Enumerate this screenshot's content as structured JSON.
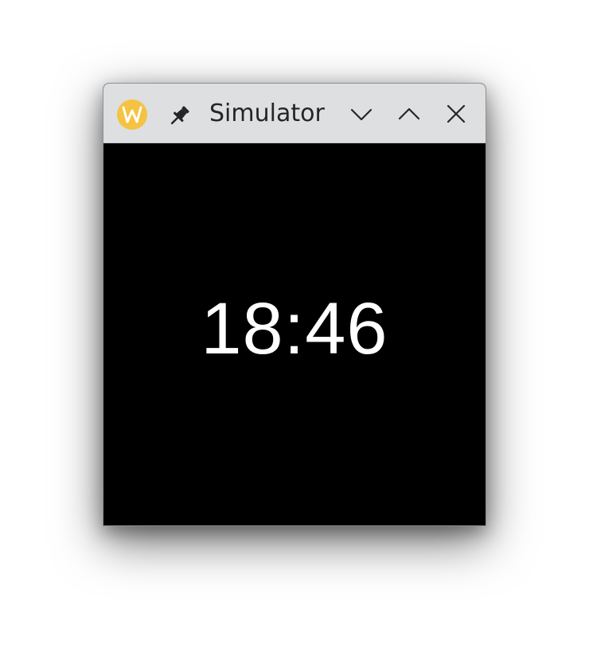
{
  "window": {
    "title": "Simulator",
    "app_icon": "wayland-w-icon",
    "buttons": {
      "pin": "pin-icon",
      "minimize": "chevron-down-icon",
      "maximize": "chevron-up-icon",
      "close": "close-icon"
    }
  },
  "screen": {
    "time": "18:46",
    "background_color": "#000000",
    "text_color": "#ffffff"
  },
  "colors": {
    "titlebar": "#dedfe1",
    "app_icon": "#f5c242",
    "title_text": "#232629"
  }
}
